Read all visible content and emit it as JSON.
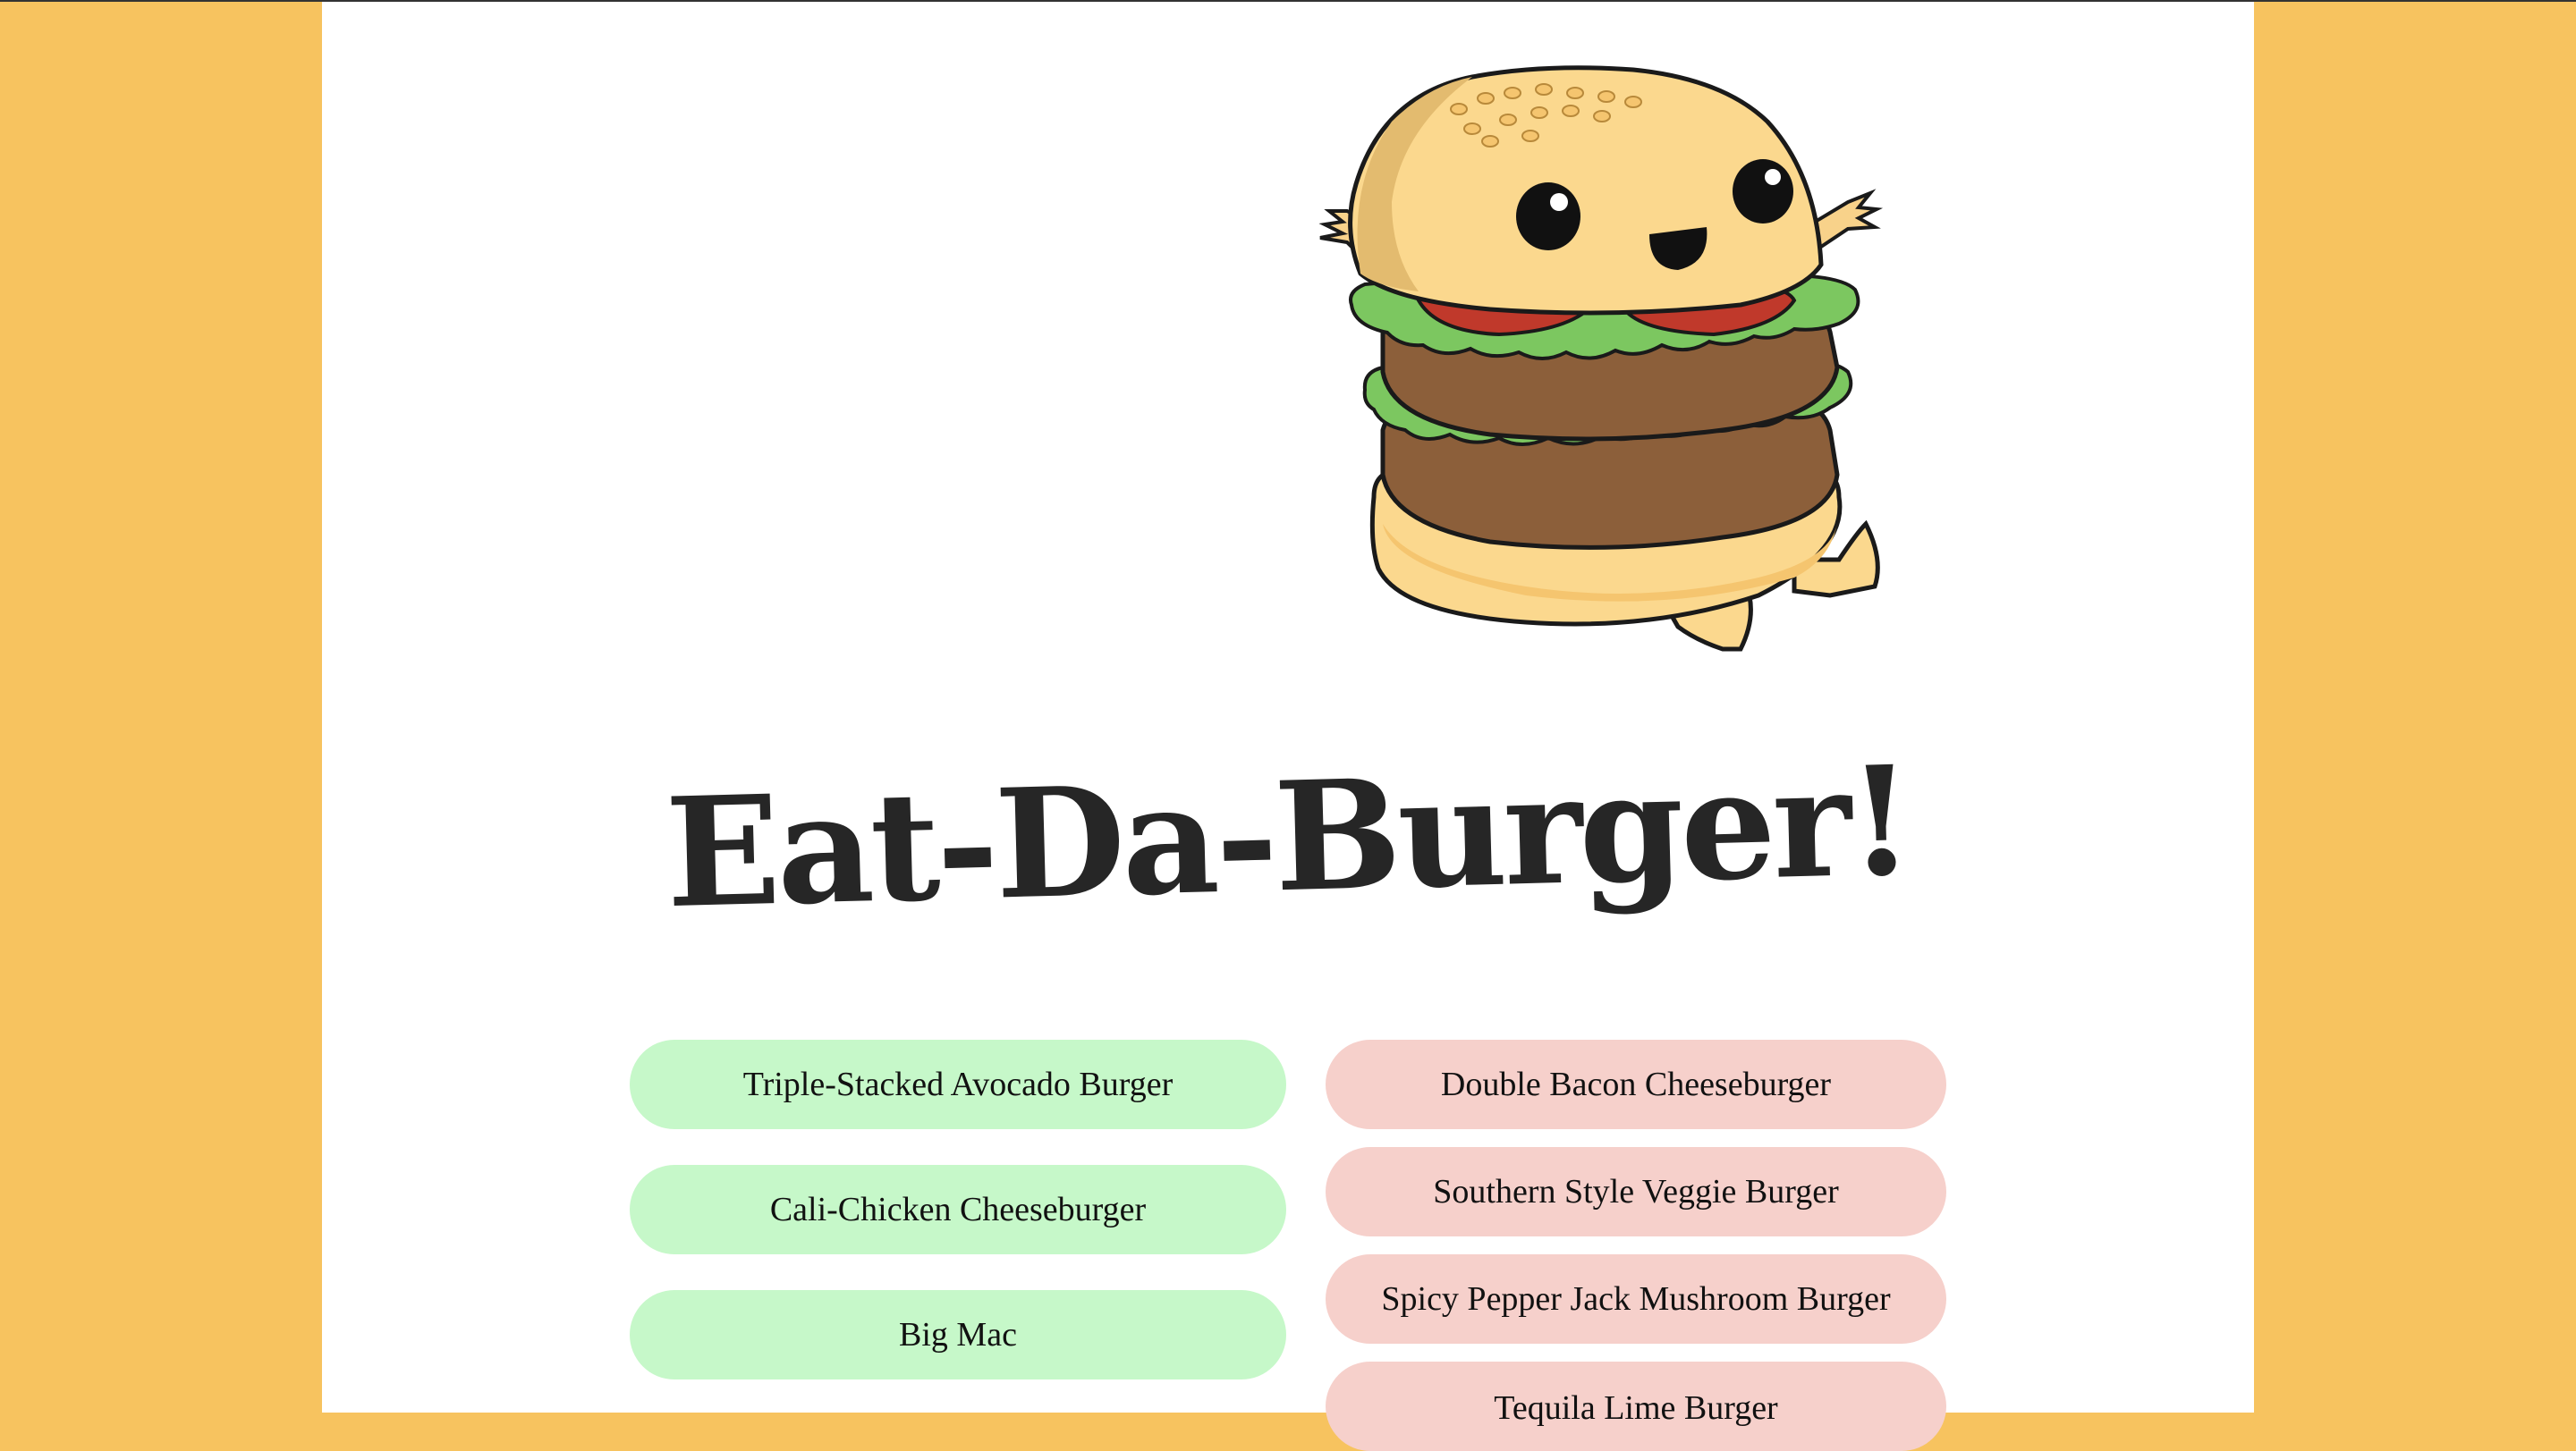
{
  "app": {
    "title": "Eat-Da-Burger!"
  },
  "mascot": {
    "icon": "cute-burger-mascot-icon"
  },
  "burgers_to_eat": [
    {
      "name": "Triple-Stacked Avocado Burger"
    },
    {
      "name": "Cali-Chicken Cheeseburger"
    },
    {
      "name": "Big Mac"
    }
  ],
  "burgers_devoured": [
    {
      "name": "Double Bacon Cheeseburger"
    },
    {
      "name": "Southern Style Veggie Burger"
    },
    {
      "name": "Spicy Pepper Jack Mushroom Burger"
    },
    {
      "name": "Tequila Lime Burger"
    }
  ],
  "colors": {
    "background": "#f7c35f",
    "page": "#ffffff",
    "to_eat_pill": "#c6f8c9",
    "devoured_pill": "#f6d0cb",
    "title": "#262626"
  }
}
